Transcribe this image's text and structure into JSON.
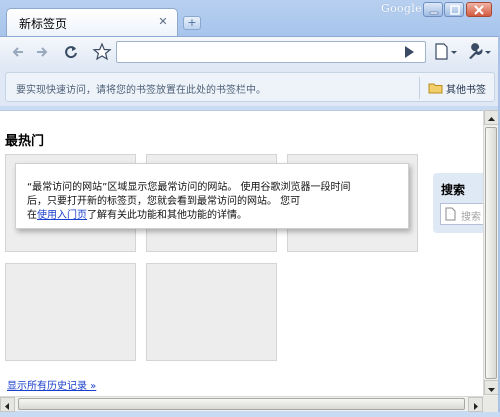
{
  "window": {
    "brand": "Google",
    "colors": {
      "frame": "#a7c4ec",
      "accent_link": "#1a3fcc"
    }
  },
  "tab": {
    "title": "新标签页",
    "close_icon": "close-icon",
    "new_tab_icon": "plus-icon"
  },
  "toolbar": {
    "back_icon": "back-arrow-icon",
    "forward_icon": "forward-arrow-icon",
    "reload_icon": "reload-icon",
    "star_icon": "star-icon",
    "omnibox_value": "",
    "go_icon": "go-arrow-icon",
    "page_menu_icon": "page-menu-icon",
    "wrench_menu_icon": "wrench-icon"
  },
  "bookmarks": {
    "hint": "要实现快速访问，请将您的书签放置在此处的书签栏中。",
    "other_label": "其他书签"
  },
  "content": {
    "most_visited_title": "最热门",
    "info_line1": "“最常访问的网站”区域显示您最常访问的网站。 使用谷歌浏览器一段时间",
    "info_line2": "后，只要打开新的标签页，您就会看到最常访问的网站。 您可",
    "info_line3_prefix": "在",
    "info_link": "使用入门页",
    "info_line3_suffix": "了解有关此功能和其他功能的详情。",
    "search_title": "搜索",
    "search_placeholder": "搜索",
    "history_link": "显示所有历史记录 »"
  }
}
